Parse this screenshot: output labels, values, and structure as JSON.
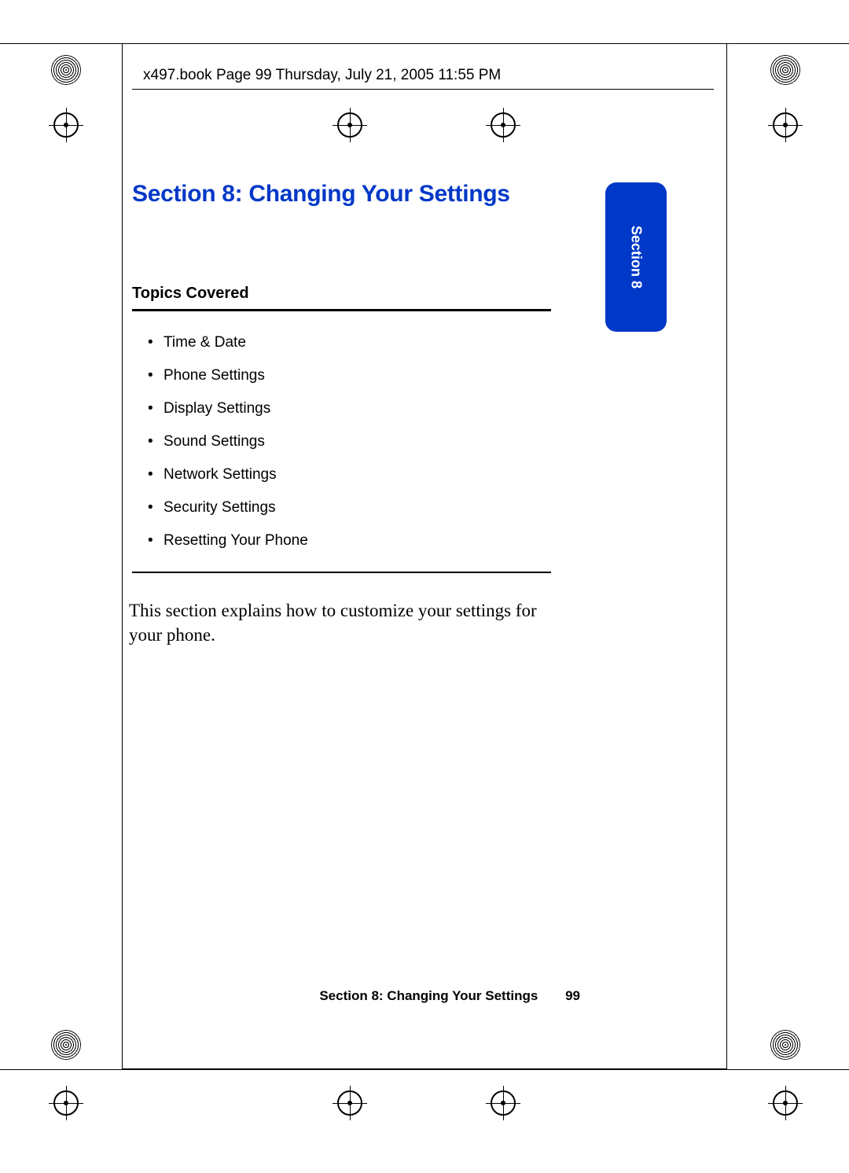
{
  "header": {
    "text": "x497.book  Page 99  Thursday, July 21, 2005  11:55 PM"
  },
  "section": {
    "title": "Section 8: Changing Your Settings",
    "side_tab": "Section 8"
  },
  "topics": {
    "heading": "Topics Covered",
    "items": [
      "Time & Date",
      "Phone Settings",
      "Display Settings",
      "Sound Settings",
      "Network Settings",
      "Security Settings",
      "Resetting Your Phone"
    ]
  },
  "body": "This section explains how to customize your settings for your phone.",
  "footer": {
    "title": "Section 8: Changing Your Settings",
    "page": "99"
  }
}
